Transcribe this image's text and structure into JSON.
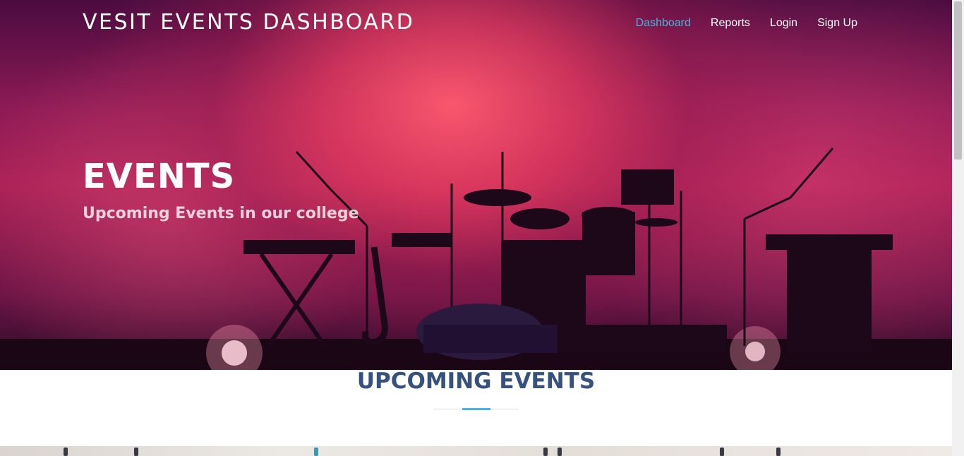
{
  "navbar": {
    "brand": "VESIT EVENTS DASHBOARD",
    "links": [
      {
        "label": "Dashboard",
        "active": true
      },
      {
        "label": "Reports",
        "active": false
      },
      {
        "label": "Login",
        "active": false
      },
      {
        "label": "Sign Up",
        "active": false
      }
    ]
  },
  "hero": {
    "title": "EVENTS",
    "subtitle": "Upcoming Events in our college",
    "image": "concert-stage-silhouette"
  },
  "section": {
    "title": "UPCOMING EVENTS"
  },
  "colors": {
    "accent": "#47b2e4",
    "heading": "#37517e",
    "hero_glow": "#e5405f"
  }
}
